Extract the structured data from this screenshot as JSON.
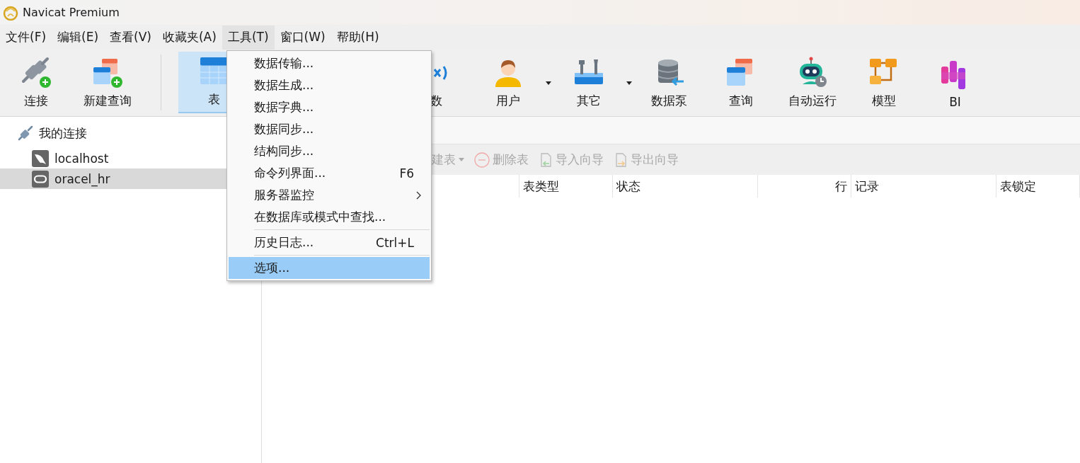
{
  "window": {
    "title": "Navicat Premium"
  },
  "menu_bar": [
    {
      "label": "文件(F)",
      "selected": false
    },
    {
      "label": "编辑(E)",
      "selected": false
    },
    {
      "label": "查看(V)",
      "selected": false
    },
    {
      "label": "收藏夹(A)",
      "selected": false
    },
    {
      "label": "工具(T)",
      "selected": true
    },
    {
      "label": "窗口(W)",
      "selected": false
    },
    {
      "label": "帮助(H)",
      "selected": false
    }
  ],
  "toolbar": [
    {
      "label": "连接",
      "kind": "connect",
      "selected": false,
      "dropdown": false
    },
    {
      "label": "新建查询",
      "kind": "new-query",
      "selected": false,
      "dropdown": false
    },
    {
      "label": "表",
      "kind": "table",
      "selected": true,
      "dropdown": false,
      "separator_before": true
    },
    {
      "label": "数",
      "kind": "function",
      "selected": false,
      "dropdown": false
    },
    {
      "label": "用户",
      "kind": "user",
      "selected": false,
      "dropdown": true
    },
    {
      "label": "其它",
      "kind": "other",
      "selected": false,
      "dropdown": true
    },
    {
      "label": "数据泵",
      "kind": "pump",
      "selected": false,
      "dropdown": false
    },
    {
      "label": "查询",
      "kind": "query",
      "selected": false,
      "dropdown": false
    },
    {
      "label": "自动运行",
      "kind": "automation",
      "selected": false,
      "dropdown": false
    },
    {
      "label": "模型",
      "kind": "model",
      "selected": false,
      "dropdown": false
    },
    {
      "label": "BI",
      "kind": "bi",
      "selected": false,
      "dropdown": false
    }
  ],
  "tools_menu": [
    {
      "label": "数据传输...",
      "selected": false
    },
    {
      "label": "数据生成...",
      "selected": false
    },
    {
      "label": "数据字典...",
      "selected": false
    },
    {
      "label": "数据同步...",
      "selected": false
    },
    {
      "label": "结构同步...",
      "selected": false
    },
    {
      "label": "命令列界面...",
      "shortcut": "F6",
      "selected": false
    },
    {
      "label": "服务器监控",
      "submenu": true,
      "selected": false
    },
    {
      "label": "在数据库或模式中查找...",
      "selected": false
    },
    {
      "label": "历史日志...",
      "shortcut": "Ctrl+L",
      "separator_before": true,
      "selected": false
    },
    {
      "label": "选项...",
      "separator_before": true,
      "selected": true
    }
  ],
  "sidebar": {
    "items": [
      {
        "label": "我的连接",
        "kind": "group",
        "selected": false,
        "children": [
          {
            "label": "localhost",
            "kind": "mysql",
            "selected": false
          },
          {
            "label": "oracel_hr",
            "kind": "oracle",
            "selected": true
          }
        ]
      }
    ]
  },
  "object_toolbar": [
    {
      "label": "建表",
      "kind": "new",
      "dropdown": true,
      "disabled": true
    },
    {
      "label": "删除表",
      "kind": "delete",
      "dropdown": false,
      "disabled": true
    },
    {
      "label": "导入向导",
      "kind": "import",
      "dropdown": false,
      "disabled": true
    },
    {
      "label": "导出向导",
      "kind": "export",
      "dropdown": false,
      "disabled": true
    }
  ],
  "table": {
    "columns": [
      {
        "label": "表类型"
      },
      {
        "label": "状态"
      },
      {
        "label": "行"
      },
      {
        "label": "记录"
      },
      {
        "label": "表锁定"
      }
    ]
  }
}
